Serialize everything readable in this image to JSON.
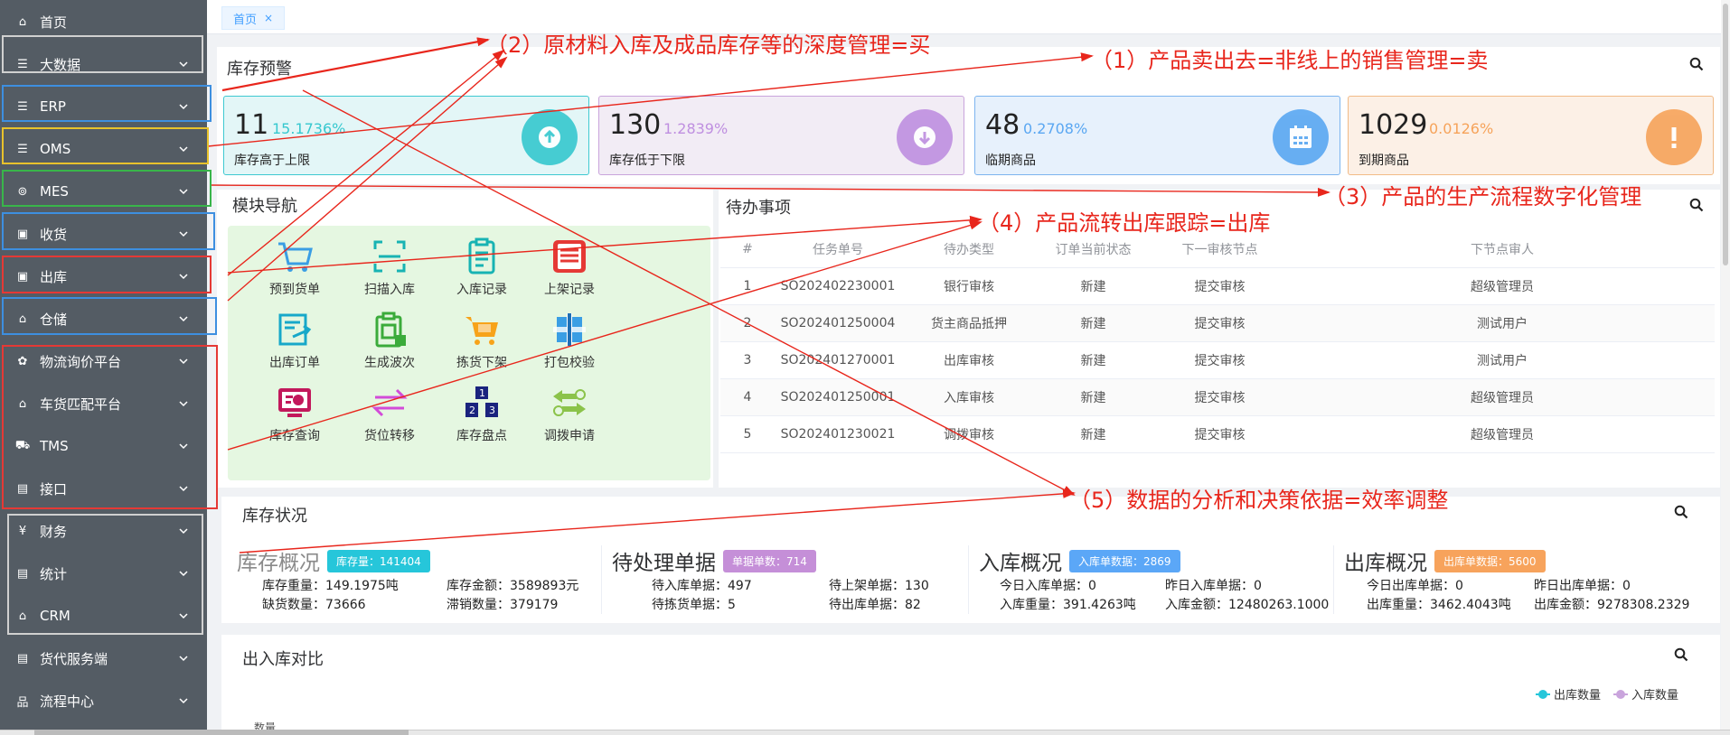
{
  "sidebar": {
    "items": [
      {
        "icon": "home-icon",
        "glyph": "⌂",
        "label": "首页",
        "chevron": false
      },
      {
        "icon": "list-icon",
        "glyph": "☰",
        "label": "大数据",
        "chevron": true
      },
      {
        "icon": "list-icon",
        "glyph": "☰",
        "label": "ERP",
        "chevron": true
      },
      {
        "icon": "list-icon",
        "glyph": "☰",
        "label": "OMS",
        "chevron": true
      },
      {
        "icon": "settings-icon",
        "glyph": "⊚",
        "label": "MES",
        "chevron": true
      },
      {
        "icon": "receive-icon",
        "glyph": "▣",
        "label": "收货",
        "chevron": true
      },
      {
        "icon": "outbound-icon",
        "glyph": "▣",
        "label": "出库",
        "chevron": true
      },
      {
        "icon": "warehouse-icon",
        "glyph": "⌂",
        "label": "仓储",
        "chevron": true
      },
      {
        "icon": "logistics-icon",
        "glyph": "✿",
        "label": "物流询价平台",
        "chevron": true
      },
      {
        "icon": "truck-match-icon",
        "glyph": "⌂",
        "label": "车货匹配平台",
        "chevron": true
      },
      {
        "icon": "truck-icon",
        "glyph": "⛟",
        "label": "TMS",
        "chevron": true
      },
      {
        "icon": "interface-icon",
        "glyph": "▤",
        "label": "接口",
        "chevron": true
      },
      {
        "icon": "yen-icon",
        "glyph": "¥",
        "label": "财务",
        "chevron": true
      },
      {
        "icon": "stats-icon",
        "glyph": "▤",
        "label": "统计",
        "chevron": true
      },
      {
        "icon": "crm-icon",
        "glyph": "⌂",
        "label": "CRM",
        "chevron": true
      },
      {
        "icon": "freight-icon",
        "glyph": "▤",
        "label": "货代服务端",
        "chevron": true
      },
      {
        "icon": "workflow-icon",
        "glyph": "品",
        "label": "流程中心",
        "chevron": true
      }
    ],
    "frame_colors": {
      "gray": "#d0d0d0",
      "blue": "#3d8fe0",
      "yellow": "#e8c22c",
      "green": "#39b54a",
      "red": "#e53935"
    }
  },
  "tabs": [
    {
      "label": "首页",
      "close": "×"
    }
  ],
  "stock_warning": {
    "title": "库存预警",
    "boxes": [
      {
        "value": "11",
        "percent": "15.1736%",
        "label": "库存高于上限",
        "icon": "arrow-up-circle-icon",
        "bg": "#e3f6f7",
        "border": "#3ec9d1",
        "accent": "#36c8cf"
      },
      {
        "value": "130",
        "percent": "1.2839%",
        "label": "库存低于下限",
        "icon": "arrow-down-circle-icon",
        "bg": "#f2ecf5",
        "border": "#c9a4dc",
        "accent": "#bf8fe0"
      },
      {
        "value": "48",
        "percent": "0.2708%",
        "label": "临期商品",
        "icon": "calendar-icon",
        "bg": "#e7f1fc",
        "border": "#7db4ef",
        "accent": "#5aa7f2"
      },
      {
        "value": "1029",
        "percent": "0.0126%",
        "label": "到期商品",
        "icon": "exclamation-icon",
        "bg": "#fcf0e6",
        "border": "#f2bb87",
        "accent": "#f6a35a"
      }
    ]
  },
  "module_nav": {
    "title": "模块导航",
    "items": [
      {
        "label": "预到货单",
        "icon": "cart-icon"
      },
      {
        "label": "扫描入库",
        "icon": "scan-icon"
      },
      {
        "label": "入库记录",
        "icon": "clipboard-icon"
      },
      {
        "label": "上架记录",
        "icon": "shelf-record-icon"
      },
      {
        "label": "出库订单",
        "icon": "outbound-order-icon"
      },
      {
        "label": "生成波次",
        "icon": "wave-icon"
      },
      {
        "label": "拣货下架",
        "icon": "picking-cart-icon"
      },
      {
        "label": "打包校验",
        "icon": "package-check-icon"
      },
      {
        "label": "库存查询",
        "icon": "stock-query-icon"
      },
      {
        "label": "货位转移",
        "icon": "transfer-icon"
      },
      {
        "label": "库存盘点",
        "icon": "stocktake-icon"
      },
      {
        "label": "调拨申请",
        "icon": "allocation-icon"
      }
    ]
  },
  "todo": {
    "title": "待办事项",
    "headers": [
      "#",
      "任务单号",
      "待办类型",
      "订单当前状态",
      "下一审核节点",
      "下节点审人"
    ],
    "rows": [
      [
        "1",
        "SO202402230001",
        "银行审核",
        "新建",
        "提交审核",
        "超级管理员"
      ],
      [
        "2",
        "SO202401250004",
        "货主商品抵押",
        "新建",
        "提交审核",
        "测试用户"
      ],
      [
        "3",
        "SO202401270001",
        "出库审核",
        "新建",
        "提交审核",
        "测试用户"
      ],
      [
        "4",
        "SO202401250001",
        "入库审核",
        "新建",
        "提交审核",
        "超级管理员"
      ],
      [
        "5",
        "SO202401230021",
        "调拨审核",
        "新建",
        "提交审核",
        "超级管理员"
      ]
    ]
  },
  "stock_status": {
    "title": "库存状况",
    "blocks": [
      {
        "name": "库存概况",
        "badge": "库存量：141404",
        "badge_color": "#26c6da",
        "rows": [
          [
            "库存重量：149.1975吨",
            "库存金额：3589893元"
          ],
          [
            "缺货数量：73666",
            "滞销数量：379179"
          ]
        ]
      },
      {
        "name": "待处理单据",
        "badge": "单据单数：714",
        "badge_color": "#c58fd8",
        "rows": [
          [
            "待入库单据：497",
            "待上架单据：130"
          ],
          [
            "待拣货单据：5",
            "待出库单据：82"
          ]
        ]
      },
      {
        "name": "入库概况",
        "badge": "入库单数据：2869",
        "badge_color": "#5ba7f7",
        "rows": [
          [
            "今日入库单据：0",
            "昨日入库单据：0"
          ],
          [
            "入库重量：391.4263吨",
            "入库金额：12480263.1000"
          ]
        ]
      },
      {
        "name": "出库概况",
        "badge": "出库单数据：5600",
        "badge_color": "#f7a35c",
        "rows": [
          [
            "今日出库单据：0",
            "昨日出库单据：0"
          ],
          [
            "出库重量：3462.4043吨",
            "出库金额：9278308.2329"
          ]
        ]
      }
    ]
  },
  "compare": {
    "title": "出入库对比",
    "y_label": "数量",
    "legend": [
      {
        "name": "出库数量",
        "color": "#26c6da"
      },
      {
        "name": "入库数量",
        "color": "#c9a4dc"
      }
    ]
  },
  "annotations": [
    "（1）产品卖出去=非线上的销售管理=卖",
    "（2）原材料入库及成品库存等的深度管理=买",
    "（3）产品的生产流程数字化管理",
    "（4）产品流转出库跟踪=出库",
    "（5）数据的分析和决策依据=效率调整"
  ]
}
